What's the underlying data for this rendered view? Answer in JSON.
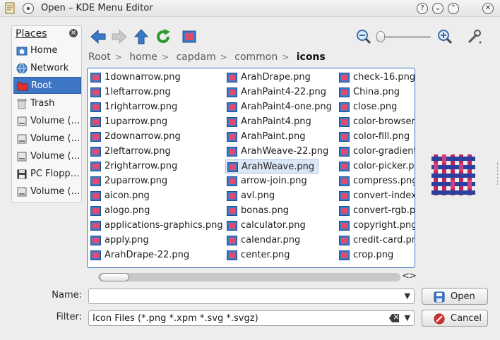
{
  "window": {
    "title": "Open – KDE Menu Editor",
    "help_glyph": "?",
    "minimize_glyph": "⌄",
    "maximize_glyph": "⌃",
    "close_glyph": "✕"
  },
  "places": {
    "header": "Places",
    "close_glyph": "×",
    "items": [
      {
        "label": "Home",
        "icon": "home-icon"
      },
      {
        "label": "Network",
        "icon": "network-icon"
      },
      {
        "label": "Root",
        "icon": "root-folder-icon",
        "selected": true
      },
      {
        "label": "Trash",
        "icon": "trash-icon"
      },
      {
        "label": "Volume (…",
        "icon": "drive-icon"
      },
      {
        "label": "Volume (…",
        "icon": "drive-icon"
      },
      {
        "label": "Volume (…",
        "icon": "drive-icon"
      },
      {
        "label": "PC Flopp…",
        "icon": "floppy-icon"
      },
      {
        "label": "Volume (…",
        "icon": "drive-icon"
      }
    ]
  },
  "breadcrumb": {
    "items": [
      "Root",
      "home",
      "capdam",
      "common"
    ],
    "separator": ">",
    "current": "icons"
  },
  "files": {
    "columns": [
      [
        "1downarrow.png",
        "1leftarrow.png",
        "1rightarrow.png",
        "1uparrow.png",
        "2downarrow.png",
        "2leftarrow.png",
        "2rightarrow.png",
        "2uparrow.png",
        "aicon.png",
        "alogo.png",
        "applications-graphics.png",
        "apply.png",
        "ArahDrape-22.png"
      ],
      [
        "ArahDrape.png",
        "ArahPaint4-22.png",
        "ArahPaint4-one.png",
        "ArahPaint4.png",
        "ArahPaint.png",
        "ArahWeave-22.png",
        "ArahWeave.png",
        "arrow-join.png",
        "avl.png",
        "bonas.png",
        "calculator.png",
        "calendar.png",
        "center.png"
      ],
      [
        "check-16.png",
        "China.png",
        "close.png",
        "color-browser.",
        "color-fill.png",
        "color-gradient",
        "color-picker.pr",
        "compress.png",
        "convert-indexe",
        "convert-rgb.pr",
        "copyright.png",
        "credit-card.pn",
        "crop.png"
      ]
    ],
    "selected": "ArahWeave.png"
  },
  "scroll": {
    "left_glyph": "<",
    "right_glyph": ">"
  },
  "name_field": {
    "label": "Name:",
    "value": ""
  },
  "filter_field": {
    "label": "Filter:",
    "value": "Icon Files (*.png *.xpm *.svg *.svgz)"
  },
  "buttons": {
    "open": "Open",
    "cancel": "Cancel"
  },
  "colors": {
    "accent": "#3d76c4",
    "selection": "#dbe7f6"
  }
}
